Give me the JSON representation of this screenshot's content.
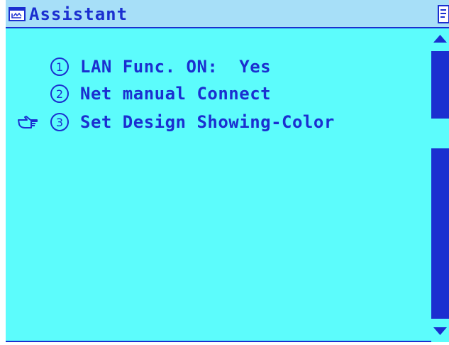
{
  "title": "Assistant",
  "icons": {
    "title": "window-app-icon",
    "corner": "document-icon",
    "pointer": "hand-pointer-icon",
    "scroll_up": "triangle-up-icon",
    "scroll_down": "triangle-down-icon"
  },
  "menu": {
    "selected_index": 2,
    "items": [
      {
        "number": "1",
        "label": "LAN Func. ON:  Yes"
      },
      {
        "number": "2",
        "label": "Net manual Connect"
      },
      {
        "number": "3",
        "label": "Set Design Showing-Color"
      }
    ]
  },
  "colors": {
    "title_bar": "#a7dff8",
    "background": "#5cfcfc",
    "text": "#1b2fd0",
    "scrollbar": "#1b2fd0"
  }
}
